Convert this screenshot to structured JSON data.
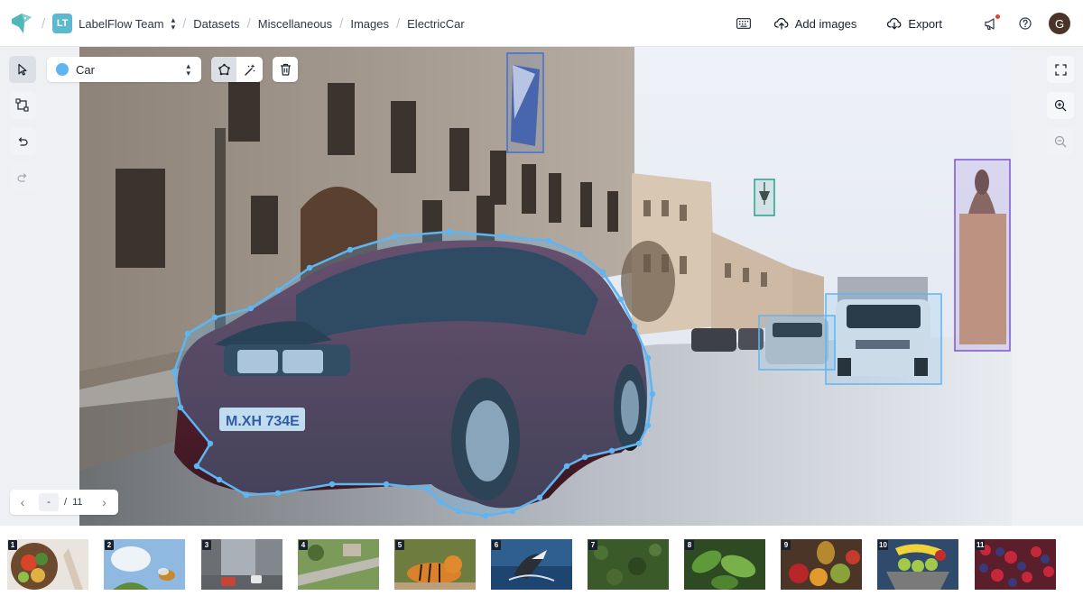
{
  "topbar": {
    "team_initials": "LT",
    "team_name": "LabelFlow Team",
    "breadcrumbs": [
      "Datasets",
      "Miscellaneous",
      "Images",
      "ElectricCar"
    ],
    "add_images_label": "Add images",
    "export_label": "Export",
    "avatar_initial": "G",
    "icons": [
      "labelflow-logo-icon",
      "keyboard-icon",
      "upload-cloud-icon",
      "download-cloud-icon",
      "megaphone-icon",
      "help-icon"
    ]
  },
  "toolbar": {
    "selected_class": "Car",
    "selected_class_color": "#5fb5f2",
    "tools": [
      "selection-tool",
      "bounding-box-tool",
      "undo",
      "redo"
    ],
    "modes": [
      "polygon",
      "auto-polygon"
    ]
  },
  "pager": {
    "current": "-",
    "separator": "/",
    "total": "11"
  },
  "annotations_colors": {
    "car": "#5fb5f2",
    "flag": "#3c6fd8",
    "lamp": "#2aa08b",
    "tower": "#7a55d0"
  },
  "gallery": {
    "thumbnails": [
      {
        "number": "1",
        "subject": "food bowl"
      },
      {
        "number": "2",
        "subject": "bee"
      },
      {
        "number": "3",
        "subject": "city street"
      },
      {
        "number": "4",
        "subject": "aerial road"
      },
      {
        "number": "5",
        "subject": "tiger"
      },
      {
        "number": "6",
        "subject": "whale"
      },
      {
        "number": "7",
        "subject": "forest aerial"
      },
      {
        "number": "8",
        "subject": "leaves"
      },
      {
        "number": "9",
        "subject": "fruit"
      },
      {
        "number": "10",
        "subject": "fruit basket"
      },
      {
        "number": "11",
        "subject": "berries"
      }
    ]
  }
}
